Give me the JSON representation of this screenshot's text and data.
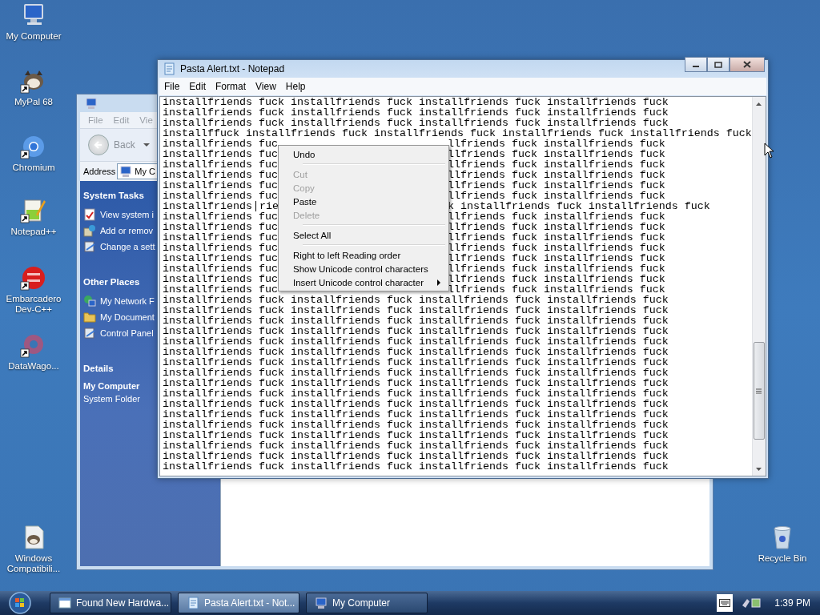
{
  "desktop_icons": [
    {
      "label": "My Computer",
      "kind": "computer",
      "shortcut": false
    },
    {
      "label": "MyPal 68",
      "kind": "mypal",
      "shortcut": true
    },
    {
      "label": "Chromium",
      "kind": "chromium",
      "shortcut": true
    },
    {
      "label": "Notepad++",
      "kind": "notepadpp",
      "shortcut": true
    },
    {
      "label": "Embarcadero Dev-C++",
      "kind": "devcpp",
      "shortcut": true
    },
    {
      "label": "DataWago...",
      "kind": "datawagon",
      "shortcut": true
    },
    {
      "label": "Windows Compatibili...",
      "kind": "compat",
      "shortcut": false
    },
    {
      "label": "Recycle Bin",
      "kind": "recycle",
      "shortcut": false
    }
  ],
  "explorer": {
    "menu": [
      "File",
      "Edit",
      "Vie"
    ],
    "back_label": "Back",
    "address_label": "Address",
    "address_value": "My C",
    "panels": [
      {
        "title": "System Tasks",
        "items": [
          {
            "label": "View system i",
            "kind": "info"
          },
          {
            "label": "Add or remov",
            "kind": "programs"
          },
          {
            "label": "Change a sett",
            "kind": "panel"
          }
        ]
      },
      {
        "title": "Other Places",
        "items": [
          {
            "label": "My Network F",
            "kind": "network"
          },
          {
            "label": "My Document",
            "kind": "folder"
          },
          {
            "label": "Control Panel",
            "kind": "panel"
          }
        ]
      }
    ],
    "details": {
      "title": "Details",
      "name": "My Computer",
      "type": "System Folder"
    }
  },
  "notepad": {
    "title": "Pasta Alert.txt - Notepad",
    "menu": [
      "File",
      "Edit",
      "Format",
      "View",
      "Help"
    ],
    "lines": [
      {
        "text": "installfriends fuck installfriends fuck installfriends fuck installfriends fuck",
        "caret": false
      },
      {
        "text": "installfriends fuck installfriends fuck installfriends fuck installfriends fuck",
        "caret": false
      },
      {
        "text": "installfriends fuck installfriends fuck installfriends fuck installfriends fuck",
        "caret": false
      },
      {
        "text": "installffuck installfriends fuck installfriends fuck installfriends fuck installfriends fuck",
        "caret": false
      },
      {
        "left": "installfriends fuc",
        "right": "llfriends fuck installfriends fuck",
        "caret": false
      },
      {
        "left": "installfriends fuc",
        "right": "llfriends fuck installfriends fuck",
        "caret": false
      },
      {
        "left": "installfriends fuc",
        "right": "llfriends fuck installfriends fuck",
        "caret": false
      },
      {
        "left": "installfriends fuc",
        "right": "llfriends fuck installfriends fuck",
        "caret": false
      },
      {
        "left": "installfriends fuc",
        "right": "llfriends fuck installfriends fuck",
        "caret": false
      },
      {
        "left": "installfriends fuc",
        "right": "llfriends fuck installfriends fuck",
        "caret": false
      },
      {
        "left": "installfriends",
        "caret": true,
        "after_caret": "rie",
        "right": "k installfriends fuck installfriends fuck"
      },
      {
        "left": "installfriends fuc",
        "right": "llfriends fuck installfriends fuck",
        "caret": false
      },
      {
        "left": "installfriends fuc",
        "right": "llfriends fuck installfriends fuck",
        "caret": false
      },
      {
        "left": "installfriends fuc",
        "right": "llfriends fuck installfriends fuck",
        "caret": false
      },
      {
        "left": "installfriends fuc",
        "right": "llfriends fuck installfriends fuck",
        "caret": false
      },
      {
        "left": "installfriends fuc",
        "right": "llfriends fuck installfriends fuck",
        "caret": false
      },
      {
        "left": "installfriends fuc",
        "right": "llfriends fuck installfriends fuck",
        "caret": false
      },
      {
        "left": "installfriends fuc",
        "right": "llfriends fuck installfriends fuck",
        "caret": false
      },
      {
        "left": "installfriends fuc",
        "right": "llfriends fuck installfriends fuck",
        "caret": false
      },
      {
        "text": "installfriends fuck installfriends fuck installfriends fuck installfriends fuck",
        "caret": false
      },
      {
        "text": "installfriends fuck installfriends fuck installfriends fuck installfriends fuck",
        "caret": false
      },
      {
        "text": "installfriends fuck installfriends fuck installfriends fuck installfriends fuck",
        "caret": false
      },
      {
        "text": "installfriends fuck installfriends fuck installfriends fuck installfriends fuck",
        "caret": false
      },
      {
        "text": "installfriends fuck installfriends fuck installfriends fuck installfriends fuck",
        "caret": false
      },
      {
        "text": "installfriends fuck installfriends fuck installfriends fuck installfriends fuck",
        "caret": false
      },
      {
        "text": "installfriends fuck installfriends fuck installfriends fuck installfriends fuck",
        "caret": false
      },
      {
        "text": "installfriends fuck installfriends fuck installfriends fuck installfriends fuck",
        "caret": false
      },
      {
        "text": "installfriends fuck installfriends fuck installfriends fuck installfriends fuck",
        "caret": false
      },
      {
        "text": "installfriends fuck installfriends fuck installfriends fuck installfriends fuck",
        "caret": false
      },
      {
        "text": "installfriends fuck installfriends fuck installfriends fuck installfriends fuck",
        "caret": false
      },
      {
        "text": "installfriends fuck installfriends fuck installfriends fuck installfriends fuck",
        "caret": false
      },
      {
        "text": "installfriends fuck installfriends fuck installfriends fuck installfriends fuck",
        "caret": false
      },
      {
        "text": "installfriends fuck installfriends fuck installfriends fuck installfriends fuck",
        "caret": false
      },
      {
        "text": "installfriends fuck installfriends fuck installfriends fuck installfriends fuck",
        "caret": false
      },
      {
        "text": "installfriends fuck installfriends fuck installfriends fuck installfriends fuck",
        "caret": false
      },
      {
        "text": "installfriends fuck installfriends fuck installfriends fuck installfriends fuck",
        "caret": false
      }
    ]
  },
  "context_menu": [
    {
      "kind": "item",
      "label": "Undo",
      "disabled": false,
      "submenu": false
    },
    {
      "kind": "separator"
    },
    {
      "kind": "item",
      "label": "Cut",
      "disabled": true,
      "submenu": false
    },
    {
      "kind": "item",
      "label": "Copy",
      "disabled": true,
      "submenu": false
    },
    {
      "kind": "item",
      "label": "Paste",
      "disabled": false,
      "submenu": false
    },
    {
      "kind": "item",
      "label": "Delete",
      "disabled": true,
      "submenu": false
    },
    {
      "kind": "separator"
    },
    {
      "kind": "item",
      "label": "Select All",
      "disabled": false,
      "submenu": false
    },
    {
      "kind": "separator"
    },
    {
      "kind": "item",
      "label": "Right to left Reading order",
      "disabled": false,
      "submenu": false
    },
    {
      "kind": "item",
      "label": "Show Unicode control characters",
      "disabled": false,
      "submenu": false
    },
    {
      "kind": "item",
      "label": "Insert Unicode control character",
      "disabled": false,
      "submenu": true
    }
  ],
  "taskbar": {
    "buttons": [
      {
        "label": "Found New Hardwa...",
        "kind": "window",
        "selected": false
      },
      {
        "label": "Pasta Alert.txt - Not...",
        "kind": "notepad",
        "selected": true
      },
      {
        "label": "My Computer",
        "kind": "computer",
        "selected": false
      }
    ],
    "clock": "1:39 PM"
  }
}
